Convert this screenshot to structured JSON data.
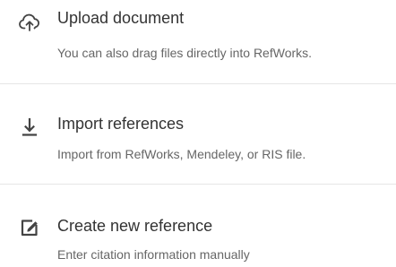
{
  "menu": {
    "items": [
      {
        "icon": "cloud-upload-icon",
        "title": "Upload document",
        "description": "You can also drag files directly into RefWorks."
      },
      {
        "icon": "download-arrow-icon",
        "title": "Import references",
        "description": "Import from RefWorks, Mendeley, or RIS file."
      },
      {
        "icon": "edit-square-icon",
        "title": "Create new reference",
        "description": "Enter citation information manually"
      }
    ]
  },
  "colors": {
    "title_text": "#333333",
    "description_text": "#666666",
    "icon": "#444444",
    "divider": "#e6e6e6",
    "background": "#ffffff"
  }
}
